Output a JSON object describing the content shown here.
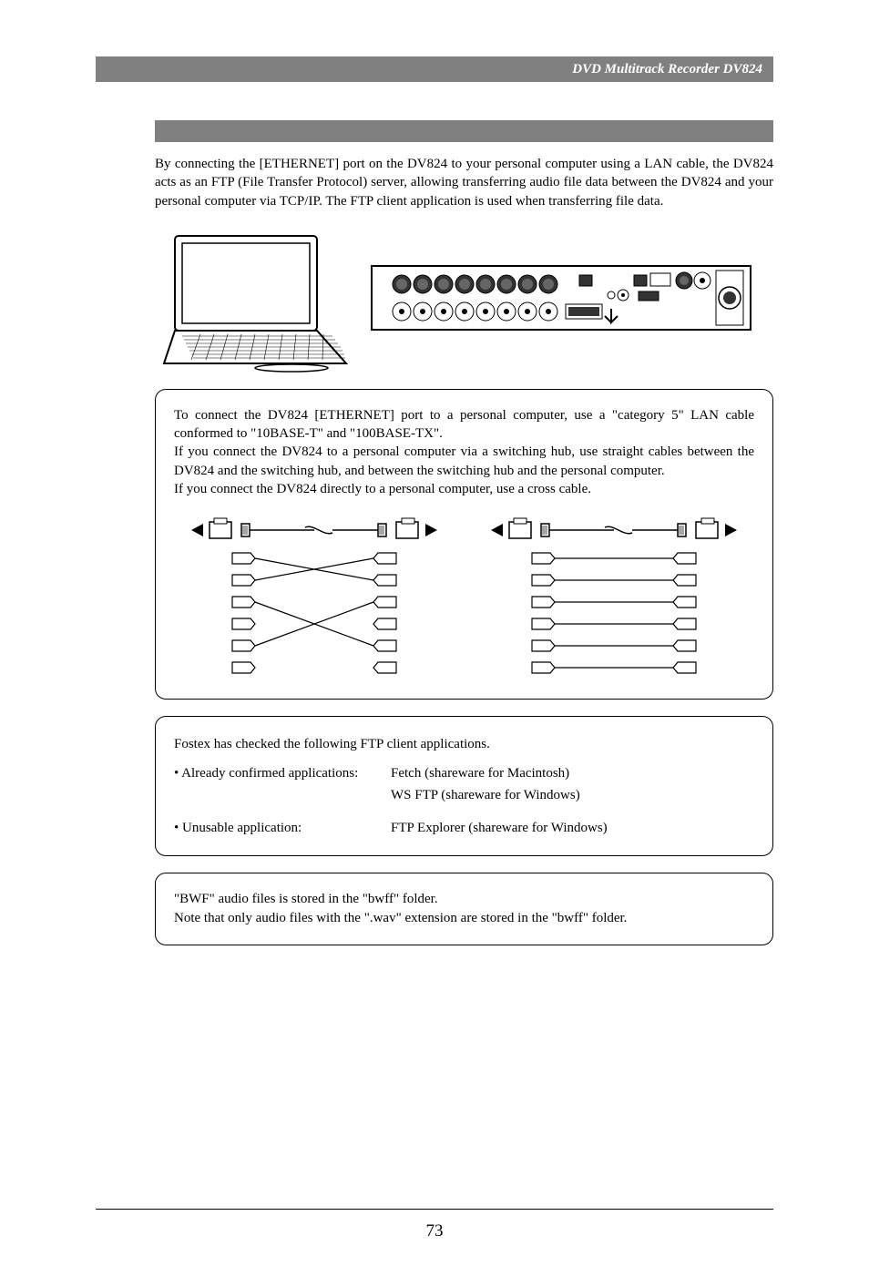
{
  "header": {
    "title": "DVD Multitrack Recorder DV824"
  },
  "intro": "By connecting the [ETHERNET] port on the DV824 to your personal computer using a LAN cable, the DV824 acts as an FTP (File Transfer Protocol) server, allowing transferring audio file data between the DV824 and your personal computer via TCP/IP. The FTP client application is used when transferring file data.",
  "note1": {
    "p1": "To connect the DV824 [ETHERNET] port to a personal computer, use a \"category 5\" LAN cable conformed to \"10BASE-T\" and \"100BASE-TX\".",
    "p2": "If you connect the DV824 to a personal computer via a switching hub, use straight cables between the DV824 and the switching hub, and between the switching hub and the personal computer.",
    "p3": "If you connect the DV824 directly to a personal computer, use a cross cable."
  },
  "memo": {
    "intro": "Fostex has checked the following FTP client applications.",
    "row1_label": "• Already confirmed applications:",
    "row1_val1": "Fetch (shareware for Macintosh)",
    "row1_val2": "WS FTP (shareware for Windows)",
    "row2_label": "• Unusable application:",
    "row2_val": "FTP Explorer (shareware for Windows)"
  },
  "note3": {
    "p1": "\"BWF\" audio files is stored in the \"bwff\" folder.",
    "p2": "Note that only audio files with the \".wav\" extension are stored in the \"bwff\" folder."
  },
  "page_number": "73"
}
